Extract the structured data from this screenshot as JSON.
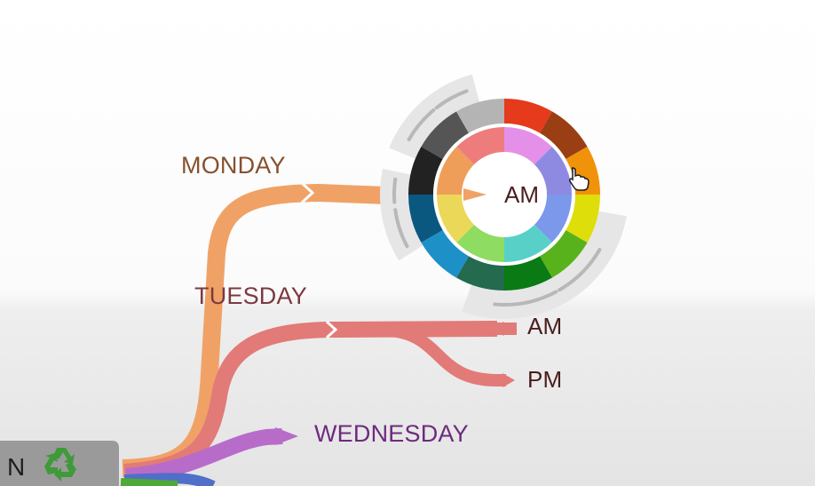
{
  "colors": {
    "monday": "#f0a266",
    "tuesday": "#e27a77",
    "wednesday": "#b86cc9",
    "monday_text": "#86512f",
    "tuesday_text": "#7b3a41",
    "wednesday_text": "#6e2b7d",
    "ink": "#4a1e1e"
  },
  "root_node": {
    "label": "N",
    "icon": "recycle-icon"
  },
  "branches": [
    {
      "label": "MONDAY"
    },
    {
      "label": "TUESDAY"
    },
    {
      "label": "WEDNESDAY"
    }
  ],
  "tuesday_children": [
    {
      "label": "AM"
    },
    {
      "label": "PM"
    }
  ],
  "color_picker": {
    "center_label": "AM",
    "cursor": "hand-pointer-icon",
    "outer_ring": [
      "#e53a1c",
      "#9a3e14",
      "#f0920a",
      "#dede0a",
      "#58b21c",
      "#0a7a14",
      "#236a4f",
      "#1e90c8",
      "#0a5880",
      "#222222",
      "#555555",
      "#b4b4b4"
    ],
    "inner_ring": [
      "#e490e8",
      "#8e8ae2",
      "#7c98ea",
      "#58d0c8",
      "#8edc62",
      "#ecd858",
      "#ef9e5a",
      "#ee7c7c"
    ]
  }
}
